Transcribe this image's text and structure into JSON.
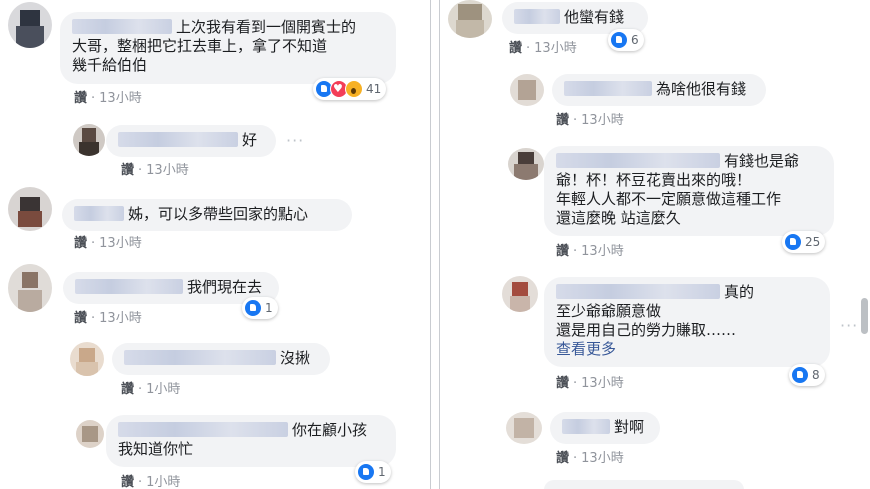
{
  "meta_like": "讚",
  "meta_sep": "·",
  "left": [
    {
      "lines": [
        "上次我有看到一個開賓士的",
        "大哥，整梱把它扛去車上，拿了不知道",
        "幾千給伯伯"
      ],
      "time": "13小時",
      "reactions": "41"
    },
    {
      "lines": [
        "好"
      ],
      "time": "13小時"
    },
    {
      "lines": [
        "姊，可以多帶些回家的點心"
      ],
      "time": "13小時"
    },
    {
      "lines": [
        "我們現在去"
      ],
      "time": "13小時",
      "reactions": "1"
    },
    {
      "lines": [
        "沒揪"
      ],
      "time": "1小時"
    },
    {
      "lines": [
        "你在顧小孩",
        "我知道你忙"
      ],
      "time": "1小時",
      "reactions": "1"
    }
  ],
  "right": [
    {
      "lines": [
        "他蠻有錢"
      ],
      "time": "13小時",
      "reactions": "6"
    },
    {
      "lines": [
        "為啥他很有錢"
      ],
      "time": "13小時"
    },
    {
      "lines": [
        "有錢也是爺",
        "爺！杯！杯豆花賣出來的哦！",
        "年輕人人都不一定願意做這種工作",
        "還這麼晚 站這麼久"
      ],
      "time": "13小時",
      "reactions": "25"
    },
    {
      "lines": [
        "真的",
        "至少爺爺願意做",
        "還是用自己的勞力賺取……"
      ],
      "see_more": "查看更多",
      "time": "13小時",
      "reactions": "8"
    },
    {
      "lines": [
        "對啊"
      ],
      "time": "13小時"
    }
  ],
  "more_options": "···",
  "icons": {
    "like": "like-icon",
    "love": "love-icon",
    "wow": "wow-icon",
    "more": "more-options-icon"
  },
  "colors": {
    "bubble": "#f2f3f5",
    "link": "#385898",
    "meta": "#90949c",
    "like_blue": "#1877f2"
  }
}
